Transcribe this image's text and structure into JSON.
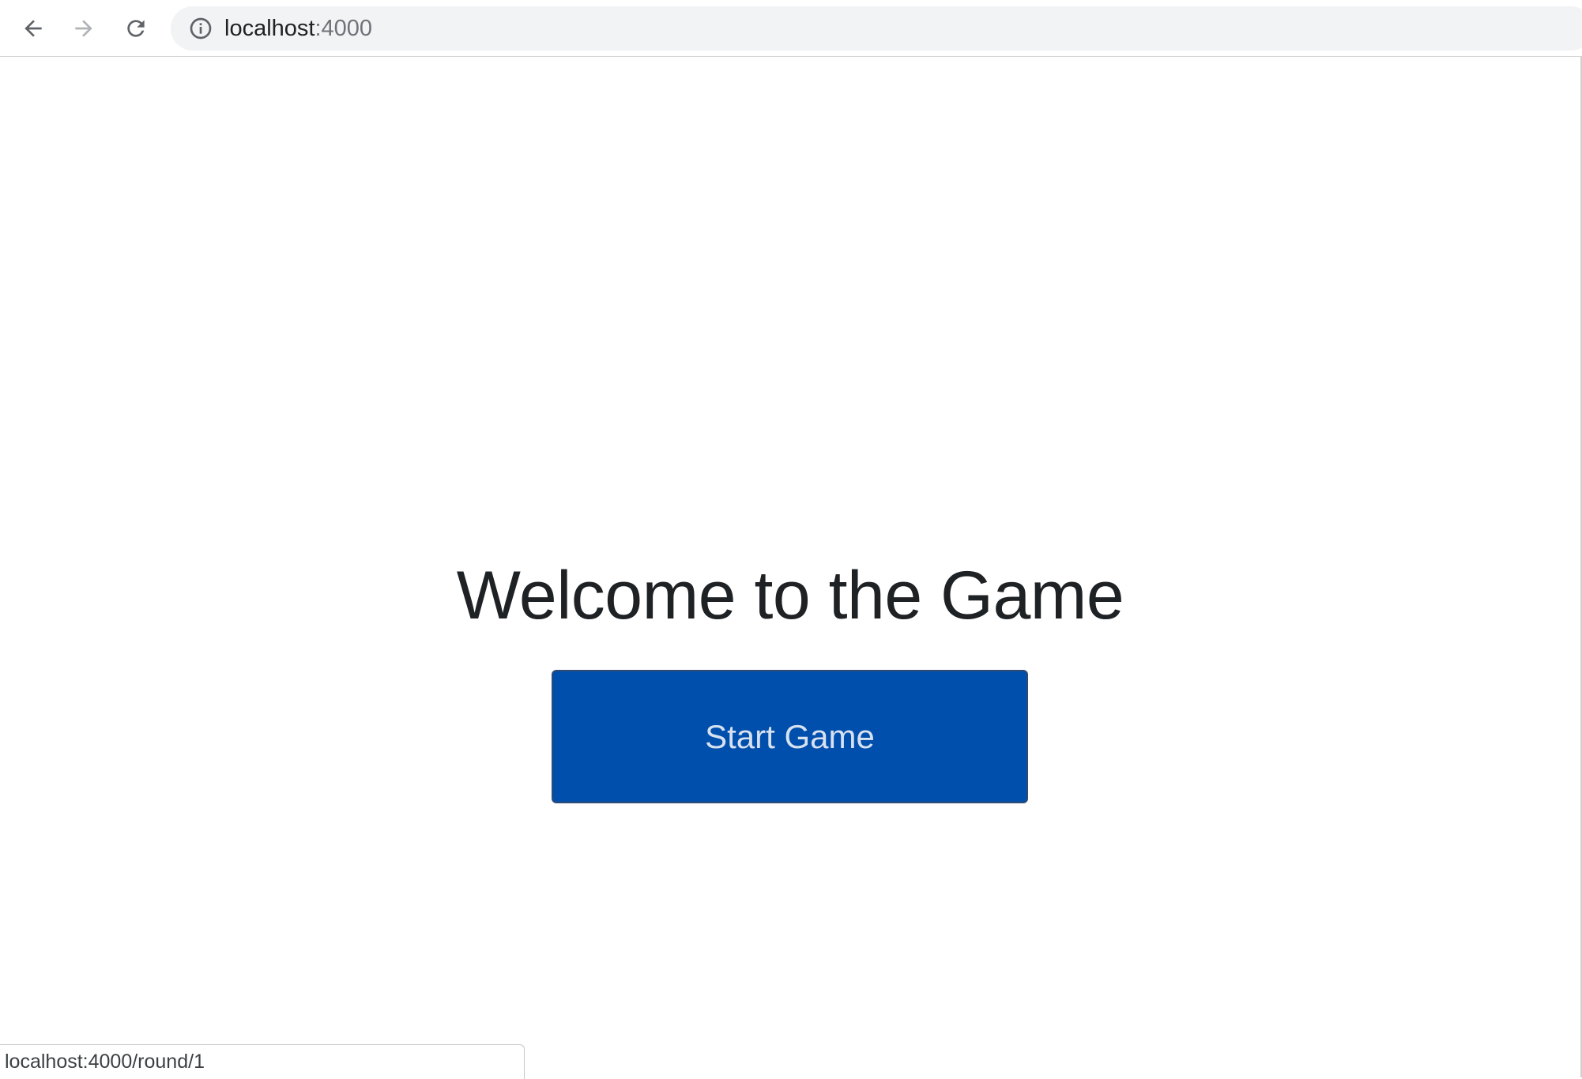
{
  "browser": {
    "address": {
      "host": "localhost",
      "port": ":4000"
    },
    "icons": {
      "back": "arrow-left-icon",
      "forward": "arrow-right-icon",
      "reload": "reload-icon",
      "site_info": "info-icon"
    },
    "status_url": "localhost:4000/round/1"
  },
  "page": {
    "title": "Welcome to the Game",
    "start_button_label": "Start Game"
  },
  "colors": {
    "button_background": "#004fac",
    "button_text": "#d7e1f0",
    "title_text": "#1f2225",
    "address_bar_background": "#f1f3f4"
  }
}
